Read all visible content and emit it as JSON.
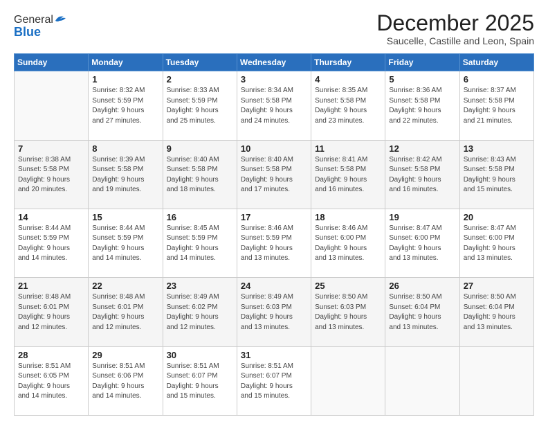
{
  "logo": {
    "general": "General",
    "blue": "Blue"
  },
  "header": {
    "month": "December 2025",
    "location": "Saucelle, Castille and Leon, Spain"
  },
  "weekdays": [
    "Sunday",
    "Monday",
    "Tuesday",
    "Wednesday",
    "Thursday",
    "Friday",
    "Saturday"
  ],
  "weeks": [
    [
      {
        "day": "",
        "info": ""
      },
      {
        "day": "1",
        "info": "Sunrise: 8:32 AM\nSunset: 5:59 PM\nDaylight: 9 hours\nand 27 minutes."
      },
      {
        "day": "2",
        "info": "Sunrise: 8:33 AM\nSunset: 5:59 PM\nDaylight: 9 hours\nand 25 minutes."
      },
      {
        "day": "3",
        "info": "Sunrise: 8:34 AM\nSunset: 5:58 PM\nDaylight: 9 hours\nand 24 minutes."
      },
      {
        "day": "4",
        "info": "Sunrise: 8:35 AM\nSunset: 5:58 PM\nDaylight: 9 hours\nand 23 minutes."
      },
      {
        "day": "5",
        "info": "Sunrise: 8:36 AM\nSunset: 5:58 PM\nDaylight: 9 hours\nand 22 minutes."
      },
      {
        "day": "6",
        "info": "Sunrise: 8:37 AM\nSunset: 5:58 PM\nDaylight: 9 hours\nand 21 minutes."
      }
    ],
    [
      {
        "day": "7",
        "info": "Sunrise: 8:38 AM\nSunset: 5:58 PM\nDaylight: 9 hours\nand 20 minutes."
      },
      {
        "day": "8",
        "info": "Sunrise: 8:39 AM\nSunset: 5:58 PM\nDaylight: 9 hours\nand 19 minutes."
      },
      {
        "day": "9",
        "info": "Sunrise: 8:40 AM\nSunset: 5:58 PM\nDaylight: 9 hours\nand 18 minutes."
      },
      {
        "day": "10",
        "info": "Sunrise: 8:40 AM\nSunset: 5:58 PM\nDaylight: 9 hours\nand 17 minutes."
      },
      {
        "day": "11",
        "info": "Sunrise: 8:41 AM\nSunset: 5:58 PM\nDaylight: 9 hours\nand 16 minutes."
      },
      {
        "day": "12",
        "info": "Sunrise: 8:42 AM\nSunset: 5:58 PM\nDaylight: 9 hours\nand 16 minutes."
      },
      {
        "day": "13",
        "info": "Sunrise: 8:43 AM\nSunset: 5:58 PM\nDaylight: 9 hours\nand 15 minutes."
      }
    ],
    [
      {
        "day": "14",
        "info": "Sunrise: 8:44 AM\nSunset: 5:59 PM\nDaylight: 9 hours\nand 14 minutes."
      },
      {
        "day": "15",
        "info": "Sunrise: 8:44 AM\nSunset: 5:59 PM\nDaylight: 9 hours\nand 14 minutes."
      },
      {
        "day": "16",
        "info": "Sunrise: 8:45 AM\nSunset: 5:59 PM\nDaylight: 9 hours\nand 14 minutes."
      },
      {
        "day": "17",
        "info": "Sunrise: 8:46 AM\nSunset: 5:59 PM\nDaylight: 9 hours\nand 13 minutes."
      },
      {
        "day": "18",
        "info": "Sunrise: 8:46 AM\nSunset: 6:00 PM\nDaylight: 9 hours\nand 13 minutes."
      },
      {
        "day": "19",
        "info": "Sunrise: 8:47 AM\nSunset: 6:00 PM\nDaylight: 9 hours\nand 13 minutes."
      },
      {
        "day": "20",
        "info": "Sunrise: 8:47 AM\nSunset: 6:00 PM\nDaylight: 9 hours\nand 13 minutes."
      }
    ],
    [
      {
        "day": "21",
        "info": "Sunrise: 8:48 AM\nSunset: 6:01 PM\nDaylight: 9 hours\nand 12 minutes."
      },
      {
        "day": "22",
        "info": "Sunrise: 8:48 AM\nSunset: 6:01 PM\nDaylight: 9 hours\nand 12 minutes."
      },
      {
        "day": "23",
        "info": "Sunrise: 8:49 AM\nSunset: 6:02 PM\nDaylight: 9 hours\nand 12 minutes."
      },
      {
        "day": "24",
        "info": "Sunrise: 8:49 AM\nSunset: 6:03 PM\nDaylight: 9 hours\nand 13 minutes."
      },
      {
        "day": "25",
        "info": "Sunrise: 8:50 AM\nSunset: 6:03 PM\nDaylight: 9 hours\nand 13 minutes."
      },
      {
        "day": "26",
        "info": "Sunrise: 8:50 AM\nSunset: 6:04 PM\nDaylight: 9 hours\nand 13 minutes."
      },
      {
        "day": "27",
        "info": "Sunrise: 8:50 AM\nSunset: 6:04 PM\nDaylight: 9 hours\nand 13 minutes."
      }
    ],
    [
      {
        "day": "28",
        "info": "Sunrise: 8:51 AM\nSunset: 6:05 PM\nDaylight: 9 hours\nand 14 minutes."
      },
      {
        "day": "29",
        "info": "Sunrise: 8:51 AM\nSunset: 6:06 PM\nDaylight: 9 hours\nand 14 minutes."
      },
      {
        "day": "30",
        "info": "Sunrise: 8:51 AM\nSunset: 6:07 PM\nDaylight: 9 hours\nand 15 minutes."
      },
      {
        "day": "31",
        "info": "Sunrise: 8:51 AM\nSunset: 6:07 PM\nDaylight: 9 hours\nand 15 minutes."
      },
      {
        "day": "",
        "info": ""
      },
      {
        "day": "",
        "info": ""
      },
      {
        "day": "",
        "info": ""
      }
    ]
  ]
}
